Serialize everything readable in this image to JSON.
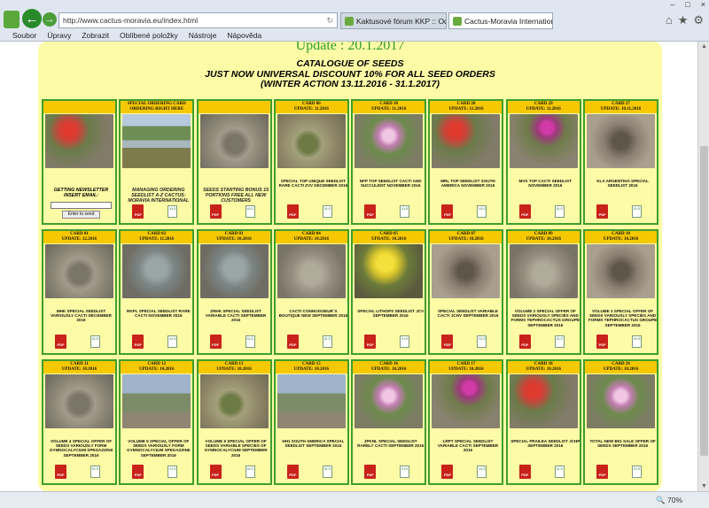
{
  "browser": {
    "url": "http://www.cactus-moravia.eu/index.html",
    "tabs": [
      {
        "label": "Kaktusové fórum KKP :: Odpov..."
      },
      {
        "label": "Cactus-Moravia International"
      }
    ],
    "menu": [
      "Soubor",
      "Úpravy",
      "Zobrazit",
      "Oblíbené položky",
      "Nástroje",
      "Nápověda"
    ],
    "zoom": "70%"
  },
  "page": {
    "update": "Update : 20.1.2017",
    "heading_lines": [
      "CATALOGUE OF SEEDS",
      "JUST NOW UNIVERSAL DISCOUNT 10% FOR ALL SEED ORDERS",
      "(WINTER ACTION 13.11.2016 - 31.1.2017)"
    ],
    "newsletter": {
      "text": "GETTING NEWSLETTER INSERT EMAIL:",
      "button": "Enter to send"
    },
    "pdf_label": "PDF",
    "xls_label": "XLS"
  },
  "cards": [
    {
      "header": "",
      "update": "",
      "text": "",
      "special": "newsletter",
      "photo": "photo-red"
    },
    {
      "header": "SPECIAL ORDERING CARD",
      "update": "ORDERING RIGHT HERE",
      "text": "MANAGING ORDERING SEEDLIST A-Z CACTUS-MORAVIA INTERNATIONAL",
      "big": true,
      "photo": "photo-river"
    },
    {
      "header": "",
      "update": "",
      "text": "SEEDS STARTING BONUS 15 PORTIONS FREE ALL NEW CUSTOMERS",
      "big": true,
      "photo": "photo-rock"
    },
    {
      "header": "CARD 06",
      "update": "UPDATE: 11.2016",
      "text": "SPECIAL TOP UNIQUE SEEDLIST RARE CACTI ZVV DECEMBER 2016",
      "photo": "photo-green"
    },
    {
      "header": "CARD 30",
      "update": "UPDATE: 11.2016",
      "text": "NFP TOP SEEDLIST CACTI AND SUCCULENT NOVEMBER 2016",
      "photo": "photo-pink"
    },
    {
      "header": "CARD 28",
      "update": "UPDATE: 11.2016",
      "text": "MRL TOP SEEDLIST SOUTH AMERICA NOVEMBER 2016",
      "photo": "photo-red"
    },
    {
      "header": "CARD 29",
      "update": "UPDATE: 11.2016",
      "text": "MVS TOP CACTI SEEDLIST NOVEMBER 2016",
      "photo": "photo-magenta"
    },
    {
      "header": "CARD 27",
      "update": "UPDATE: 10.11.2016",
      "text": "KLA ARGENTINA SPECIAL SEEDLIST 2016",
      "photo": "photo-dry"
    },
    {
      "header": "CARD 01",
      "update": "UPDATE: 12.2016",
      "text": "MHK SPECIAL SEEDLIST VARIOUSLY CACTI DECEMBER 2016",
      "photo": "photo-rock"
    },
    {
      "header": "CARD 02",
      "update": "UPDATE: 11.2016",
      "text": "RKPL SPECIAL SEEDLIST RARE CACTI NOVEMBER 2016",
      "photo": "photo-grey"
    },
    {
      "header": "CARD 03",
      "update": "UPDATE: 10.2016",
      "text": "ZRHK SPECIAL SEEDLIST VARIABLE CACTI SEPTEMBER 2016",
      "photo": "photo-grey"
    },
    {
      "header": "CARD 04",
      "update": "UPDATE: 10.2016",
      "text": "CACTI CONNOISSEUR´S BOUTIQUE NEW SEPTEMBER 2016",
      "photo": "photo-stones"
    },
    {
      "header": "CARD 05",
      "update": "UPDATE: 10.2016",
      "text": "SPECIAL LITHOPS SEEDLIST JCV SEPTEMBER 2016",
      "photo": "photo-yellow"
    },
    {
      "header": "CARD 07",
      "update": "UPDATE: 10.2016",
      "text": "SPECIAL SEEDLIST VARIABLE CACTI JCHV SEPTEMBER 2016",
      "photo": "photo-dry"
    },
    {
      "header": "CARD 09",
      "update": "UPDATE: 10.2016",
      "text": "VOLUME 2 SPECIAL OFFER OF SEEDS VARIOUSLY SPECIES AND FORMS TEPHROCACTUS GROUPE SEPTEMBER 2016",
      "photo": "photo-stones"
    },
    {
      "header": "CARD 10",
      "update": "UPDATE: 10.2016",
      "text": "VOLUME 3 SPECIAL OFFER OF SEEDS VARIOUSLY SPECIES AND FORMS TEPHROCACTUS GROUPE SEPTEMBER 2016",
      "photo": "photo-dry"
    },
    {
      "header": "CARD 11",
      "update": "UPDATE: 10.2016",
      "text": "VOLUME 4 SPECIAL OFFER OF SEEDS VARIOUSLY FORM GYMNOCALYCIUM SPEGAZZINII SEPTEMBER 2016",
      "photo": "photo-rock"
    },
    {
      "header": "CARD 12",
      "update": "UPDATE: 10.2016",
      "text": "VOLUME 5 SPECIAL OFFER OF SEEDS VARIOUSLY FORM GYMNOCALYCIUM SPEGAZZINII SEPTEMBER 2016",
      "photo": "photo-sky"
    },
    {
      "header": "CARD 13",
      "update": "UPDATE: 10.2016",
      "text": "VOLUME 6 SPECIAL OFFER OF SEEDS VARIABLE SPECIES OF GYMNOCALYCIUM SEPTEMBER 2016",
      "photo": "photo-green"
    },
    {
      "header": "CARD 15",
      "update": "UPDATE: 10.2016",
      "text": "HH1 SOUTH AMERICA SPECIAL SEEDLIST SEPTEMBER 2016",
      "photo": "photo-sky"
    },
    {
      "header": "CARD 16",
      "update": "UPDATE: 10.2016",
      "text": "JPKNL SPECIAL SEEDLIST RARELY CACTI SEPTEMBER 2016",
      "photo": "photo-pink"
    },
    {
      "header": "CARD 17",
      "update": "UPDATE: 10.2016",
      "text": "LRPT SPECIAL SEEDLIST VARIABLE CACTI SEPTEMBER 2016",
      "photo": "photo-magenta"
    },
    {
      "header": "CARD 18",
      "update": "UPDATE: 10.2016",
      "text": "SPECIAL FRAILEA SEEDLIST JCHP SEPTEMBER 2016",
      "photo": "photo-red"
    },
    {
      "header": "CARD 26",
      "update": "UPDATE: 10.2016",
      "text": "TOTAL NEW BIG SALE OFFER OF SEEDS SEPTEMBER 2016",
      "photo": "photo-pink"
    }
  ]
}
